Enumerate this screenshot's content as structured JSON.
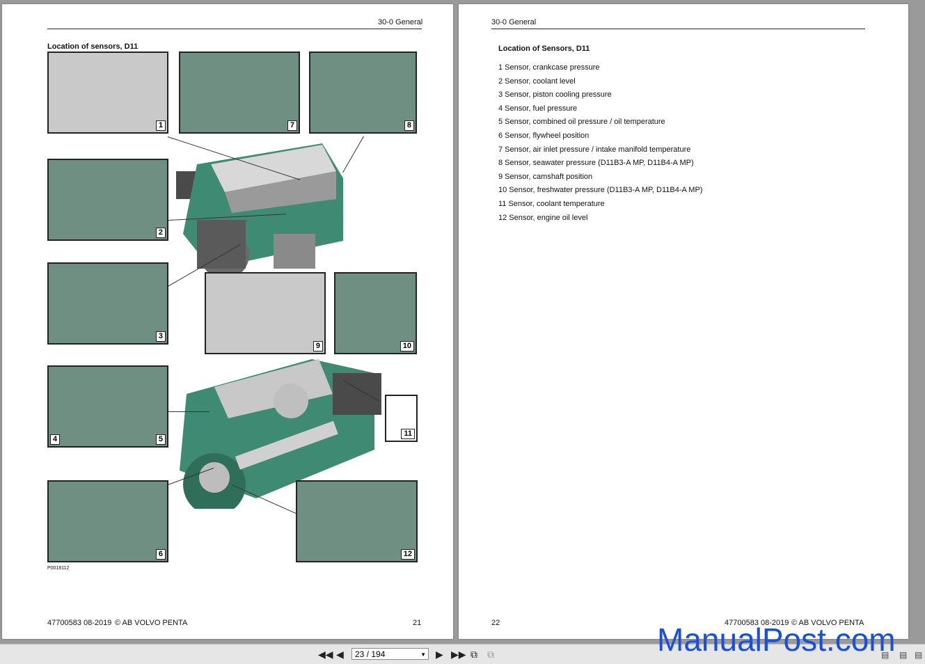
{
  "left_page": {
    "header": "30-0 General",
    "section_title": "Location of sensors, D11",
    "panel_numbers": [
      "1",
      "7",
      "8",
      "2",
      "3",
      "9",
      "10",
      "4",
      "5",
      "11",
      "6",
      "12"
    ],
    "figure_ref": "P0018112",
    "footer_doc": "47700583 08-2019",
    "footer_copyright": "© AB VOLVO PENTA",
    "page_number": "21"
  },
  "right_page": {
    "header": "30-0 General",
    "section_title": "Location of Sensors, D11",
    "items": [
      "1   Sensor, crankcase pressure",
      "2   Sensor, coolant level",
      "3   Sensor, piston cooling pressure",
      "4   Sensor, fuel pressure",
      "5   Sensor, combined oil pressure / oil temperature",
      "6   Sensor, flywheel position",
      "7   Sensor, air inlet pressure / intake manifold temperature",
      "8   Sensor, seawater pressure (D11B3-A MP, D11B4-A MP)",
      "9   Sensor, camshaft position",
      "10 Sensor, freshwater pressure (D11B3-A MP, D11B4-A MP)",
      "11 Sensor, coolant temperature",
      "12 Sensor, engine oil level"
    ],
    "page_number": "22",
    "footer_doc": "47700583 08-2019",
    "footer_copyright": "© AB VOLVO PENTA"
  },
  "toolbar": {
    "first_icon": "first-page-icon",
    "prev_icon": "prev-page-icon",
    "page_value": "23 / 194",
    "next_icon": "next-page-icon",
    "last_icon": "last-page-icon"
  },
  "watermark": "ManualPost.com",
  "colors": {
    "engine_green": "#3f8a72",
    "engine_grey": "#7a7a7a",
    "watermark": "#1a4fd8"
  }
}
